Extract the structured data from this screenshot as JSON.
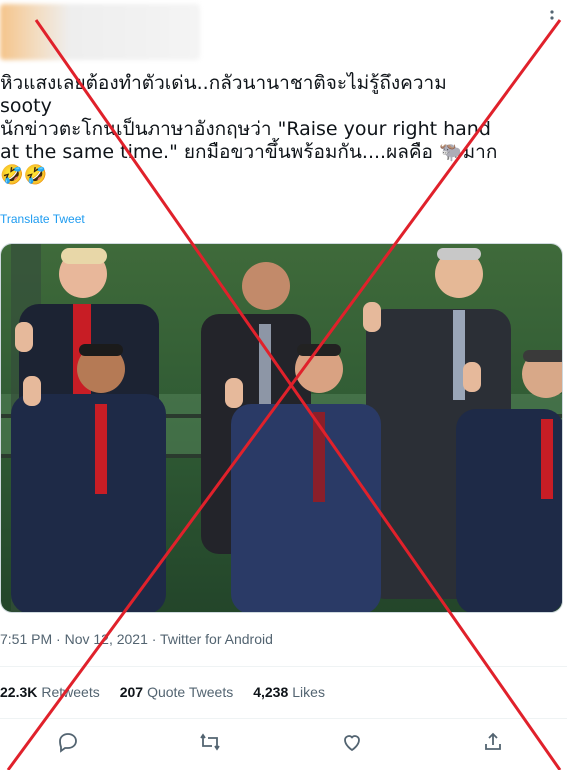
{
  "tweet": {
    "text_line1": "หิวแสงเลยต้องทำตัวเด่น..กลัวนานาชาติจะไม่รู้ถึงความ",
    "text_line2": "sooty",
    "text_line3": "นักข่าวตะโกนเป็นภาษาอังกฤษว่า \"Raise your right hand",
    "text_line4": "at the same time.\" ยกมือขวาขึ้นพร้อมกัน....ผลคือ 🐃มาก",
    "text_line5": "🤣🤣",
    "translate_label": "Translate Tweet",
    "timestamp": "7:51 PM · Nov 12, 2021 · Twitter for Android"
  },
  "stats": {
    "retweets_count": "22.3K",
    "retweets_label": "Retweets",
    "quotes_count": "207",
    "quotes_label": "Quote Tweets",
    "likes_count": "4,238",
    "likes_label": "Likes"
  },
  "icons": [
    "more-icon",
    "reply-icon",
    "retweet-icon",
    "like-icon",
    "share-icon"
  ],
  "colors": {
    "link": "#1d9bf0",
    "muted": "#536471",
    "cross": "#e0212b"
  }
}
